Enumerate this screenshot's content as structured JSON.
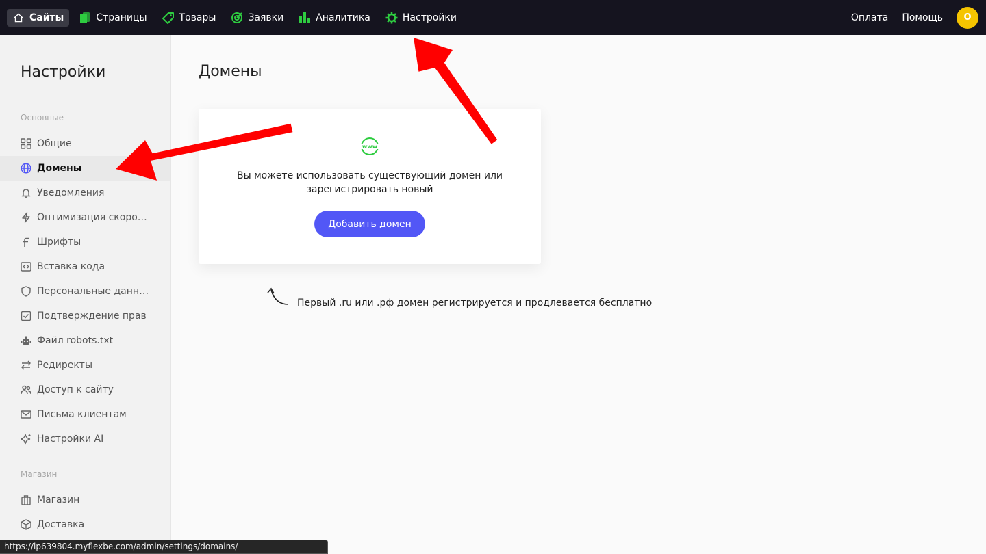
{
  "topbar": {
    "items": [
      {
        "label": "Сайты",
        "icon": "home-icon"
      },
      {
        "label": "Страницы",
        "icon": "pages-icon",
        "color": "#2ecc40"
      },
      {
        "label": "Товары",
        "icon": "tag-icon",
        "color": "#2ecc40"
      },
      {
        "label": "Заявки",
        "icon": "target-icon",
        "color": "#2ecc40"
      },
      {
        "label": "Аналитика",
        "icon": "bar-chart-icon",
        "color": "#2ecc40"
      },
      {
        "label": "Настройки",
        "icon": "gear-icon",
        "color": "#2ecc40"
      }
    ],
    "payment_label": "Оплата",
    "help_label": "Помощь",
    "avatar_letter": "О",
    "avatar_color": "#f5c400"
  },
  "sidebar": {
    "title": "Настройки",
    "section_main": "Основные",
    "items": [
      {
        "label": "Общие",
        "icon": "grid-icon"
      },
      {
        "label": "Домены",
        "icon": "globe-icon",
        "active": true
      },
      {
        "label": "Уведомления",
        "icon": "bell-icon"
      },
      {
        "label": "Оптимизация скорости",
        "icon": "lightning-icon"
      },
      {
        "label": "Шрифты",
        "icon": "font-icon"
      },
      {
        "label": "Вставка кода",
        "icon": "code-icon"
      },
      {
        "label": "Персональные данные",
        "icon": "shield-icon"
      },
      {
        "label": "Подтверждение прав",
        "icon": "checkbox-icon"
      },
      {
        "label": "Файл robots.txt",
        "icon": "robot-icon"
      },
      {
        "label": "Редиректы",
        "icon": "arrows-swap-icon"
      },
      {
        "label": "Доступ к сайту",
        "icon": "users-icon"
      },
      {
        "label": "Письма клиентам",
        "icon": "mail-icon"
      },
      {
        "label": "Настройки AI",
        "icon": "sparkle-icon"
      }
    ],
    "section_shop": "Магазин",
    "shop_items": [
      {
        "label": "Магазин",
        "icon": "shop-icon"
      },
      {
        "label": "Доставка",
        "icon": "box-icon"
      }
    ]
  },
  "main": {
    "title": "Домены",
    "card_text": "Вы можете использовать существующий домен или зарегистрировать новый",
    "add_button": "Добавить домен",
    "hint": "Первый .ru или .рф домен регистрируется и продлевается бесплатно",
    "www_icon_text": "www",
    "accent": "#5257f6"
  },
  "statusbar": {
    "url": "https://lp639804.myflexbe.com/admin/settings/domains/"
  },
  "annotation_color": "#ff0000"
}
